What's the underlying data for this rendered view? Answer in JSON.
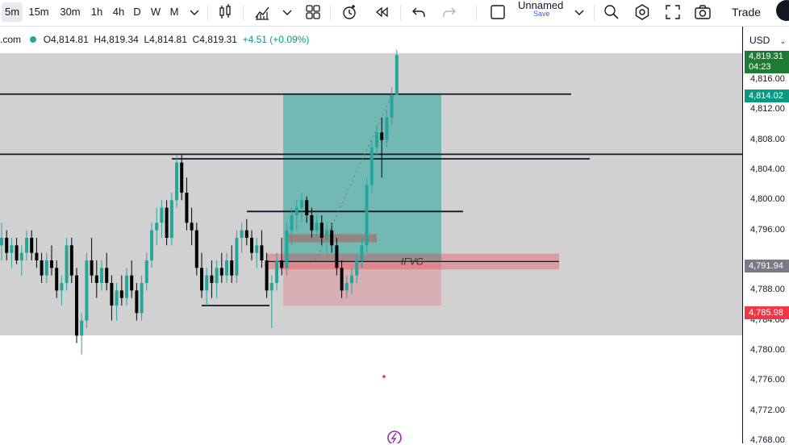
{
  "toolbar": {
    "intervals": [
      {
        "label": "5m",
        "active": true
      },
      {
        "label": "15m",
        "active": false
      },
      {
        "label": "30m",
        "active": false
      },
      {
        "label": "1h",
        "active": false
      },
      {
        "label": "4h",
        "active": false
      },
      {
        "label": "D",
        "active": false
      },
      {
        "label": "W",
        "active": false
      },
      {
        "label": "M",
        "active": false
      }
    ],
    "layout_name": "Unnamed",
    "layout_save": "Save",
    "trade_label": "Trade"
  },
  "legend": {
    "source": ".com",
    "open": "O4,814.81",
    "high": "H4,819.34",
    "low": "L4,814.81",
    "close": "C4,819.31",
    "change": "+4.51 (+0.09%)"
  },
  "price_axis": {
    "currency": "USD",
    "ticks": [
      "4,816.00",
      "4,812.00",
      "4,808.00",
      "4,804.00",
      "4,800.00",
      "4,796.00",
      "4,788.00",
      "4,784.00",
      "4,780.00",
      "4,776.00",
      "4,772.00",
      "4,768.00"
    ],
    "tags": {
      "current": {
        "price": "4,819.31",
        "countdown": "04:23",
        "color": "#1e7b34"
      },
      "target": {
        "price": "4,814.02",
        "color": "#089981"
      },
      "mid": {
        "price": "4,791.94",
        "color": "#787b86"
      },
      "stop": {
        "price": "4,785.98",
        "color": "#f23645"
      }
    }
  },
  "annotations": {
    "ifvg_label": "IFVG"
  },
  "colors": {
    "up": "#26a69a",
    "down": "#000000",
    "profit_zone": "#26a69a",
    "loss_zone": "#f23645",
    "background_band": "#d1d1d1"
  },
  "chart_data": {
    "type": "candlestick",
    "instrument_hint": "XAUUSD",
    "interval": "5m",
    "ylim": [
      4766,
      4822
    ],
    "y_ticks": [
      4816,
      4812,
      4808,
      4804,
      4800,
      4796,
      4788,
      4784,
      4780,
      4776,
      4772,
      4768
    ],
    "candles": [
      {
        "o": 4794.0,
        "h": 4797.0,
        "l": 4792.0,
        "c": 4795.0
      },
      {
        "o": 4795.0,
        "h": 4796.0,
        "l": 4792.0,
        "c": 4793.0
      },
      {
        "o": 4793.0,
        "h": 4795.0,
        "l": 4791.0,
        "c": 4794.0
      },
      {
        "o": 4794.0,
        "h": 4795.0,
        "l": 4791.5,
        "c": 4792.0
      },
      {
        "o": 4792.0,
        "h": 4794.0,
        "l": 4790.0,
        "c": 4793.0
      },
      {
        "o": 4793.0,
        "h": 4796.0,
        "l": 4792.0,
        "c": 4795.0
      },
      {
        "o": 4795.0,
        "h": 4796.0,
        "l": 4792.0,
        "c": 4793.0
      },
      {
        "o": 4793.0,
        "h": 4795.0,
        "l": 4791.0,
        "c": 4792.0
      },
      {
        "o": 4792.0,
        "h": 4793.0,
        "l": 4789.0,
        "c": 4790.0
      },
      {
        "o": 4790.0,
        "h": 4793.0,
        "l": 4789.0,
        "c": 4792.0
      },
      {
        "o": 4792.0,
        "h": 4794.0,
        "l": 4790.0,
        "c": 4791.0
      },
      {
        "o": 4791.0,
        "h": 4792.0,
        "l": 4787.0,
        "c": 4788.0
      },
      {
        "o": 4788.0,
        "h": 4790.0,
        "l": 4786.0,
        "c": 4789.0
      },
      {
        "o": 4789.0,
        "h": 4795.0,
        "l": 4788.0,
        "c": 4794.0
      },
      {
        "o": 4794.0,
        "h": 4795.0,
        "l": 4789.0,
        "c": 4790.0
      },
      {
        "o": 4790.0,
        "h": 4791.0,
        "l": 4781.0,
        "c": 4782.0
      },
      {
        "o": 4782.0,
        "h": 4785.0,
        "l": 4779.5,
        "c": 4784.0
      },
      {
        "o": 4784.0,
        "h": 4793.0,
        "l": 4783.0,
        "c": 4792.0
      },
      {
        "o": 4792.0,
        "h": 4795.0,
        "l": 4789.0,
        "c": 4790.0
      },
      {
        "o": 4790.0,
        "h": 4792.0,
        "l": 4787.0,
        "c": 4789.0
      },
      {
        "o": 4789.0,
        "h": 4792.0,
        "l": 4788.0,
        "c": 4791.0
      },
      {
        "o": 4791.0,
        "h": 4793.0,
        "l": 4788.0,
        "c": 4789.0
      },
      {
        "o": 4789.0,
        "h": 4790.0,
        "l": 4784.0,
        "c": 4786.0
      },
      {
        "o": 4786.0,
        "h": 4789.0,
        "l": 4784.0,
        "c": 4788.0
      },
      {
        "o": 4788.0,
        "h": 4790.0,
        "l": 4786.0,
        "c": 4787.0
      },
      {
        "o": 4787.0,
        "h": 4791.0,
        "l": 4786.0,
        "c": 4790.0
      },
      {
        "o": 4790.0,
        "h": 4792.0,
        "l": 4787.0,
        "c": 4788.0
      },
      {
        "o": 4788.0,
        "h": 4789.0,
        "l": 4784.0,
        "c": 4785.0
      },
      {
        "o": 4785.0,
        "h": 4790.0,
        "l": 4784.0,
        "c": 4789.0
      },
      {
        "o": 4789.0,
        "h": 4793.0,
        "l": 4788.0,
        "c": 4792.0
      },
      {
        "o": 4792.0,
        "h": 4797.0,
        "l": 4791.0,
        "c": 4796.0
      },
      {
        "o": 4796.0,
        "h": 4799.0,
        "l": 4794.0,
        "c": 4797.0
      },
      {
        "o": 4797.0,
        "h": 4800.0,
        "l": 4795.0,
        "c": 4799.0
      },
      {
        "o": 4799.0,
        "h": 4800.0,
        "l": 4794.0,
        "c": 4795.0
      },
      {
        "o": 4795.0,
        "h": 4801.0,
        "l": 4794.0,
        "c": 4800.0
      },
      {
        "o": 4800.0,
        "h": 4806.0,
        "l": 4799.0,
        "c": 4805.0
      },
      {
        "o": 4805.0,
        "h": 4806.0,
        "l": 4800.0,
        "c": 4801.0
      },
      {
        "o": 4801.0,
        "h": 4803.0,
        "l": 4796.0,
        "c": 4797.0
      },
      {
        "o": 4797.0,
        "h": 4799.0,
        "l": 4794.0,
        "c": 4796.0
      },
      {
        "o": 4796.0,
        "h": 4797.0,
        "l": 4790.0,
        "c": 4791.0
      },
      {
        "o": 4791.0,
        "h": 4793.0,
        "l": 4787.0,
        "c": 4788.0
      },
      {
        "o": 4788.0,
        "h": 4791.0,
        "l": 4786.0,
        "c": 4790.0
      },
      {
        "o": 4790.0,
        "h": 4792.0,
        "l": 4787.0,
        "c": 4789.0
      },
      {
        "o": 4789.0,
        "h": 4792.0,
        "l": 4787.0,
        "c": 4791.0
      },
      {
        "o": 4791.0,
        "h": 4793.0,
        "l": 4789.0,
        "c": 4790.0
      },
      {
        "o": 4790.0,
        "h": 4793.0,
        "l": 4789.0,
        "c": 4792.0
      },
      {
        "o": 4792.0,
        "h": 4794.0,
        "l": 4789.0,
        "c": 4790.0
      },
      {
        "o": 4790.0,
        "h": 4796.0,
        "l": 4789.0,
        "c": 4795.0
      },
      {
        "o": 4795.0,
        "h": 4797.0,
        "l": 4793.0,
        "c": 4796.0
      },
      {
        "o": 4796.0,
        "h": 4797.5,
        "l": 4794.0,
        "c": 4795.0
      },
      {
        "o": 4795.0,
        "h": 4796.0,
        "l": 4792.0,
        "c": 4793.0
      },
      {
        "o": 4793.0,
        "h": 4795.0,
        "l": 4791.0,
        "c": 4794.0
      },
      {
        "o": 4794.0,
        "h": 4796.0,
        "l": 4791.0,
        "c": 4792.0
      },
      {
        "o": 4792.0,
        "h": 4793.0,
        "l": 4787.0,
        "c": 4788.0
      },
      {
        "o": 4788.0,
        "h": 4790.0,
        "l": 4783.0,
        "c": 4789.0
      },
      {
        "o": 4789.0,
        "h": 4793.0,
        "l": 4788.0,
        "c": 4792.0
      },
      {
        "o": 4792.0,
        "h": 4795.0,
        "l": 4790.0,
        "c": 4791.0
      },
      {
        "o": 4791.0,
        "h": 4797.0,
        "l": 4790.0,
        "c": 4796.0
      },
      {
        "o": 4796.0,
        "h": 4799.0,
        "l": 4794.0,
        "c": 4798.0
      },
      {
        "o": 4798.0,
        "h": 4800.0,
        "l": 4796.0,
        "c": 4799.0
      },
      {
        "o": 4799.0,
        "h": 4801.0,
        "l": 4797.0,
        "c": 4800.0
      },
      {
        "o": 4800.0,
        "h": 4800.5,
        "l": 4797.0,
        "c": 4798.0
      },
      {
        "o": 4798.0,
        "h": 4799.0,
        "l": 4795.0,
        "c": 4796.0
      },
      {
        "o": 4796.0,
        "h": 4798.0,
        "l": 4795.0,
        "c": 4797.0
      },
      {
        "o": 4797.0,
        "h": 4798.0,
        "l": 4794.0,
        "c": 4795.0
      },
      {
        "o": 4795.0,
        "h": 4797.0,
        "l": 4793.0,
        "c": 4796.0
      },
      {
        "o": 4796.0,
        "h": 4797.0,
        "l": 4793.0,
        "c": 4794.0
      },
      {
        "o": 4794.0,
        "h": 4795.0,
        "l": 4790.0,
        "c": 4791.0
      },
      {
        "o": 4791.0,
        "h": 4792.0,
        "l": 4787.0,
        "c": 4788.0
      },
      {
        "o": 4788.0,
        "h": 4790.0,
        "l": 4787.0,
        "c": 4789.0
      },
      {
        "o": 4789.0,
        "h": 4791.0,
        "l": 4787.5,
        "c": 4790.0
      },
      {
        "o": 4790.0,
        "h": 4793.0,
        "l": 4789.0,
        "c": 4792.0
      },
      {
        "o": 4792.0,
        "h": 4795.0,
        "l": 4791.0,
        "c": 4794.0
      },
      {
        "o": 4794.0,
        "h": 4803.0,
        "l": 4793.0,
        "c": 4802.0
      },
      {
        "o": 4802.0,
        "h": 4808.0,
        "l": 4801.0,
        "c": 4807.0
      },
      {
        "o": 4807.0,
        "h": 4810.0,
        "l": 4806.0,
        "c": 4809.0
      },
      {
        "o": 4809.0,
        "h": 4811.0,
        "l": 4803.0,
        "c": 4808.0
      },
      {
        "o": 4808.0,
        "h": 4812.0,
        "l": 4807.0,
        "c": 4811.0
      },
      {
        "o": 4811.0,
        "h": 4815.0,
        "l": 4810.0,
        "c": 4814.0
      },
      {
        "o": 4814.0,
        "h": 4820.0,
        "l": 4814.0,
        "c": 4819.3
      }
    ],
    "horizontal_lines": [
      {
        "price": 4814.1
      },
      {
        "price": 4806.1
      },
      {
        "price": 4805.5
      },
      {
        "price": 4798.5
      },
      {
        "price": 4786.0
      }
    ],
    "position": {
      "type": "long",
      "entry": 4791.94,
      "target": 4814.02,
      "stop": 4785.98
    },
    "zones": [
      {
        "label": "IFVG",
        "top": 4792.9,
        "bottom": 4790.8
      },
      {
        "label": "",
        "top": 4795.5,
        "bottom": 4794.4
      }
    ]
  }
}
